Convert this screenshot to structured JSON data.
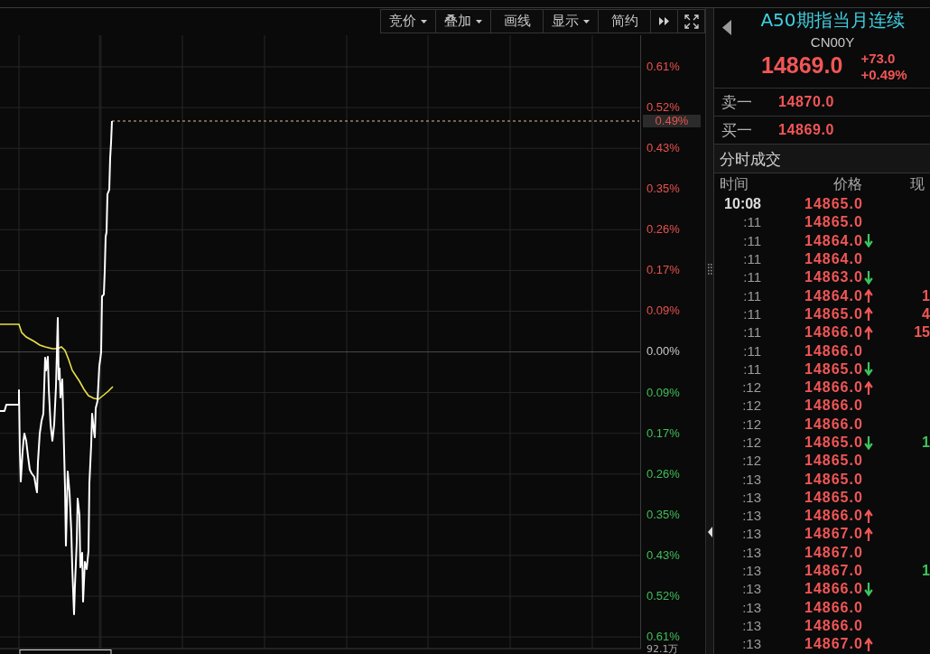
{
  "toolbar": {
    "buttons": [
      {
        "label": "竞价",
        "dropdown": true
      },
      {
        "label": "叠加",
        "dropdown": true
      },
      {
        "label": "画线",
        "dropdown": false
      },
      {
        "label": "显示",
        "dropdown": true
      },
      {
        "label": "简约",
        "dropdown": false
      }
    ]
  },
  "chart": {
    "axis_labels": [
      {
        "label": "0.61%",
        "kind": "up"
      },
      {
        "label": "0.52%",
        "kind": "up"
      },
      {
        "label": "0.43%",
        "kind": "up"
      },
      {
        "label": "0.35%",
        "kind": "up"
      },
      {
        "label": "0.26%",
        "kind": "up"
      },
      {
        "label": "0.17%",
        "kind": "up"
      },
      {
        "label": "0.09%",
        "kind": "up"
      },
      {
        "label": "0.00%",
        "kind": "zero"
      },
      {
        "label": "0.09%",
        "kind": "down"
      },
      {
        "label": "0.17%",
        "kind": "down"
      },
      {
        "label": "0.26%",
        "kind": "down"
      },
      {
        "label": "0.35%",
        "kind": "down"
      },
      {
        "label": "0.43%",
        "kind": "down"
      },
      {
        "label": "0.52%",
        "kind": "down"
      },
      {
        "label": "0.61%",
        "kind": "down"
      }
    ],
    "current_change": "0.49%",
    "volume_label": "92.1万"
  },
  "quote": {
    "title": "A50期指当月连续",
    "code": "CN00Y",
    "price": "14869.0",
    "change": "+73.0",
    "change_percent": "+0.49%",
    "order_book": [
      {
        "label": "卖一",
        "price": "14870.0"
      },
      {
        "label": "买一",
        "price": "14869.0"
      }
    ],
    "trades_title": "分时成交",
    "columns": [
      "时间",
      "价格",
      "现"
    ],
    "trades": [
      {
        "time": "10:08",
        "kind": "minute",
        "price": "14865.0",
        "rising": false,
        "falling": false
      },
      {
        "time": ":11",
        "kind": "tick",
        "price": "14865.0",
        "rising": false,
        "falling": false
      },
      {
        "time": ":11",
        "kind": "tick",
        "price": "14864.0",
        "rising": false,
        "falling": true
      },
      {
        "time": ":11",
        "kind": "tick",
        "price": "14864.0",
        "rising": false,
        "falling": false
      },
      {
        "time": ":11",
        "kind": "tick",
        "price": "14863.0",
        "rising": false,
        "falling": true
      },
      {
        "time": ":11",
        "kind": "tick",
        "price": "14864.0",
        "rising": true,
        "falling": false,
        "volume": {
          "text": "1",
          "color": "#f25656"
        }
      },
      {
        "time": ":11",
        "kind": "tick",
        "price": "14865.0",
        "rising": true,
        "falling": false,
        "volume": {
          "text": "4",
          "color": "#f25656"
        }
      },
      {
        "time": ":11",
        "kind": "tick",
        "price": "14866.0",
        "rising": true,
        "falling": false,
        "volume": {
          "text": "15",
          "color": "#f25656"
        }
      },
      {
        "time": ":11",
        "kind": "tick",
        "price": "14866.0",
        "rising": false,
        "falling": false
      },
      {
        "time": ":11",
        "kind": "tick",
        "price": "14865.0",
        "rising": false,
        "falling": true
      },
      {
        "time": ":12",
        "kind": "tick",
        "price": "14866.0",
        "rising": true,
        "falling": false
      },
      {
        "time": ":12",
        "kind": "tick",
        "price": "14866.0",
        "rising": false,
        "falling": false
      },
      {
        "time": ":12",
        "kind": "tick",
        "price": "14866.0",
        "rising": false,
        "falling": false
      },
      {
        "time": ":12",
        "kind": "tick",
        "price": "14865.0",
        "rising": false,
        "falling": true,
        "volume": {
          "text": "1",
          "color": "#3fc45e"
        }
      },
      {
        "time": ":12",
        "kind": "tick",
        "price": "14865.0",
        "rising": false,
        "falling": false
      },
      {
        "time": ":13",
        "kind": "tick",
        "price": "14865.0",
        "rising": false,
        "falling": false
      },
      {
        "time": ":13",
        "kind": "tick",
        "price": "14865.0",
        "rising": false,
        "falling": false
      },
      {
        "time": ":13",
        "kind": "tick",
        "price": "14866.0",
        "rising": true,
        "falling": false
      },
      {
        "time": ":13",
        "kind": "tick",
        "price": "14867.0",
        "rising": true,
        "falling": false
      },
      {
        "time": ":13",
        "kind": "tick",
        "price": "14867.0",
        "rising": false,
        "falling": false
      },
      {
        "time": ":13",
        "kind": "tick",
        "price": "14867.0",
        "rising": false,
        "falling": false,
        "volume": {
          "text": "1",
          "color": "#3fc45e"
        }
      },
      {
        "time": ":13",
        "kind": "tick",
        "price": "14866.0",
        "rising": false,
        "falling": true
      },
      {
        "time": ":13",
        "kind": "tick",
        "price": "14866.0",
        "rising": false,
        "falling": false
      },
      {
        "time": ":13",
        "kind": "tick",
        "price": "14866.0",
        "rising": false,
        "falling": false
      },
      {
        "time": ":13",
        "kind": "tick",
        "price": "14867.0",
        "rising": true,
        "falling": false
      }
    ]
  }
}
